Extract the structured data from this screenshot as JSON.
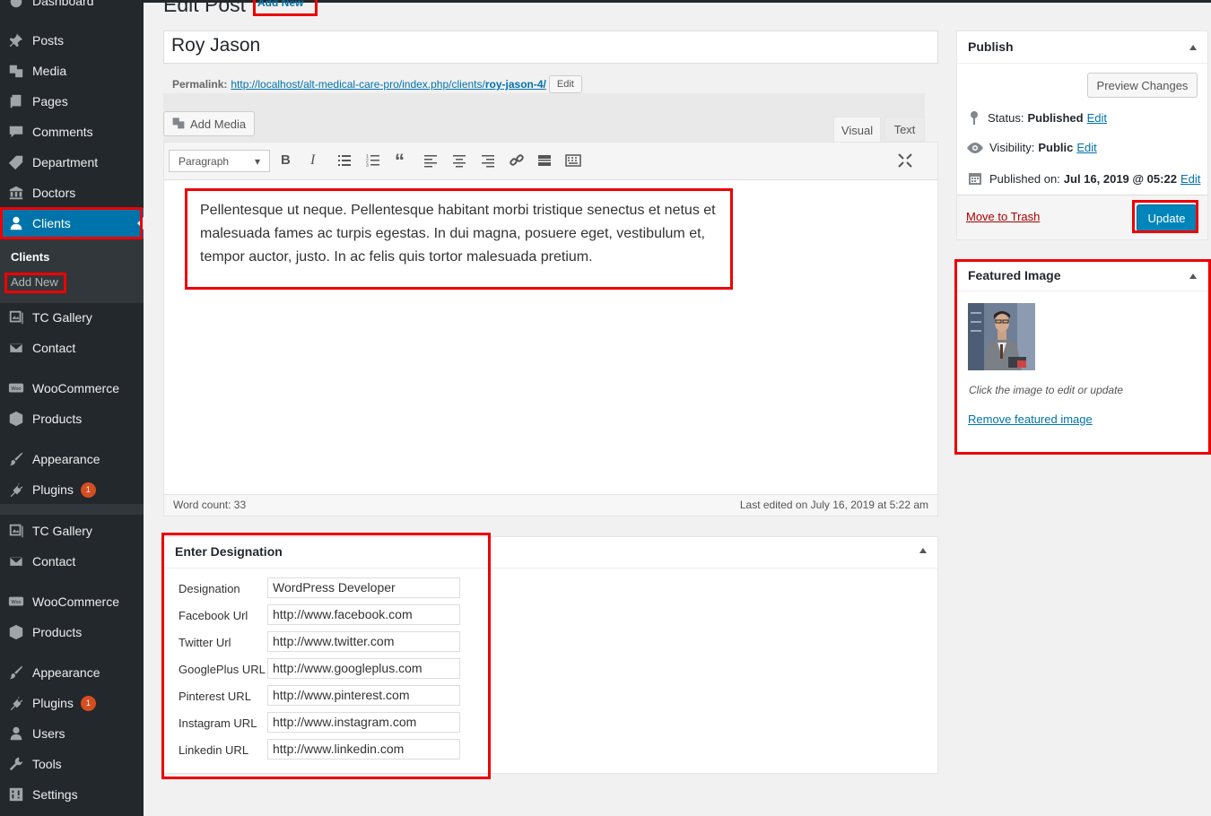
{
  "sidebar": {
    "items": [
      {
        "label": "Dashboard",
        "icon": "dashboard-icon"
      },
      {
        "label": "Posts",
        "icon": "pushpin-icon"
      },
      {
        "label": "Media",
        "icon": "media-icon"
      },
      {
        "label": "Pages",
        "icon": "pages-icon"
      },
      {
        "label": "Comments",
        "icon": "comments-icon"
      },
      {
        "label": "Department",
        "icon": "tag-icon"
      },
      {
        "label": "Doctors",
        "icon": "bank-icon"
      },
      {
        "label": "Clients",
        "icon": "user-icon"
      },
      {
        "label": "TC Gallery",
        "icon": "gallery-icon"
      },
      {
        "label": "Contact",
        "icon": "email-icon"
      },
      {
        "label": "WooCommerce",
        "icon": "woo-icon"
      },
      {
        "label": "Products",
        "icon": "box-icon"
      },
      {
        "label": "Appearance",
        "icon": "brush-icon"
      },
      {
        "label": "Plugins",
        "icon": "plug-icon",
        "badge": "1"
      },
      {
        "label": "TC Gallery",
        "icon": "gallery-icon"
      },
      {
        "label": "Contact",
        "icon": "email-icon"
      },
      {
        "label": "WooCommerce",
        "icon": "woo-icon"
      },
      {
        "label": "Products",
        "icon": "box-icon"
      },
      {
        "label": "Appearance",
        "icon": "brush-icon"
      },
      {
        "label": "Plugins",
        "icon": "plug-icon",
        "badge": "1"
      },
      {
        "label": "Users",
        "icon": "user-icon"
      },
      {
        "label": "Tools",
        "icon": "wrench-icon"
      },
      {
        "label": "Settings",
        "icon": "settings-icon"
      }
    ],
    "submenu": {
      "current": "Clients",
      "add_new": "Add New"
    }
  },
  "header": {
    "title": "Edit Post",
    "add_new": "Add New"
  },
  "post": {
    "title": "Roy Jason",
    "permalink_label": "Permalink:",
    "permalink_base": "http://localhost/alt-medical-care-pro/index.php/clients/",
    "permalink_slug": "roy-jason-4/",
    "permalink_edit": "Edit"
  },
  "editor": {
    "add_media": "Add Media",
    "tab_visual": "Visual",
    "tab_text": "Text",
    "format_select": "Paragraph",
    "content": "Pellentesque ut neque. Pellentesque habitant morbi tristique senectus et netus et malesuada fames ac turpis egestas. In dui magna, posuere eget, vestibulum et, tempor auctor, justo. In ac felis quis tortor malesuada pretium.",
    "word_count": "Word count: 33",
    "last_edited": "Last edited on July 16, 2019 at 5:22 am"
  },
  "designation_box": {
    "title": "Enter Designation",
    "fields": [
      {
        "label": "Designation",
        "value": "WordPress Developer"
      },
      {
        "label": "Facebook Url",
        "value": "http://www.facebook.com"
      },
      {
        "label": "Twitter Url",
        "value": "http://www.twitter.com"
      },
      {
        "label": "GooglePlus URL",
        "value": "http://www.googleplus.com"
      },
      {
        "label": "Pinterest URL",
        "value": "http://www.pinterest.com"
      },
      {
        "label": "Instagram URL",
        "value": "http://www.instagram.com"
      },
      {
        "label": "Linkedin URL",
        "value": "http://www.linkedin.com"
      }
    ]
  },
  "publish": {
    "title": "Publish",
    "preview": "Preview Changes",
    "status_label": "Status:",
    "status_value": "Published",
    "visibility_label": "Visibility:",
    "visibility_value": "Public",
    "published_label": "Published on:",
    "published_value": "Jul 16, 2019 @ 05:22",
    "edit": "Edit",
    "trash": "Move to Trash",
    "update": "Update"
  },
  "featured": {
    "title": "Featured Image",
    "hint": "Click the image to edit or update",
    "remove": "Remove featured image"
  },
  "colors": {
    "accent": "#0073aa",
    "sidebar": "#23282d",
    "highlight": "#e00000"
  }
}
